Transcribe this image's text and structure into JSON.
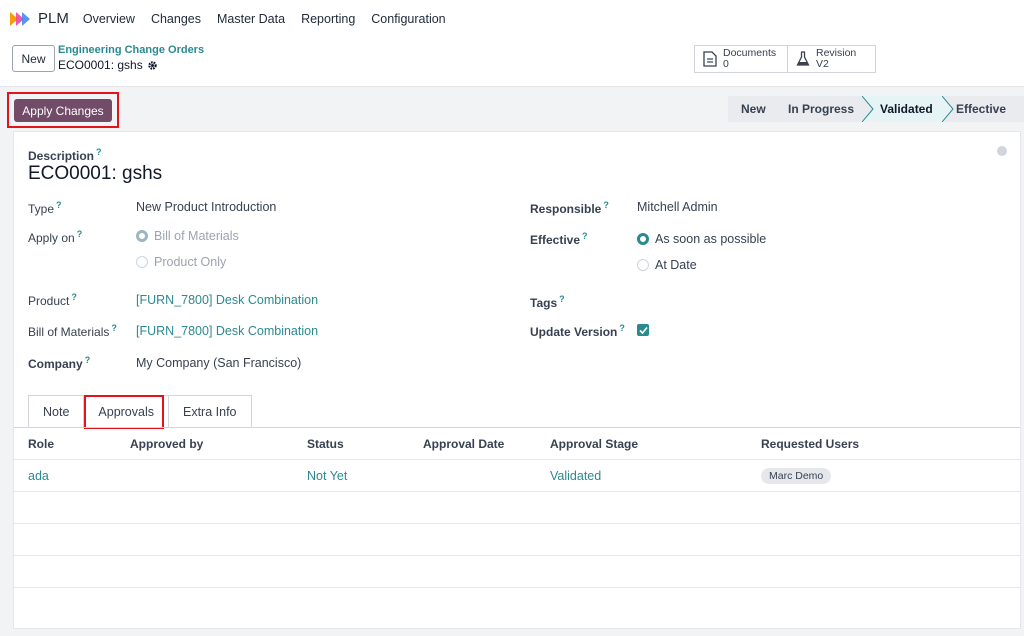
{
  "app": {
    "name": "PLM",
    "accent": "#714b67",
    "link_color": "#2a8a90"
  },
  "nav": {
    "items": [
      "Overview",
      "Changes",
      "Master Data",
      "Reporting",
      "Configuration"
    ]
  },
  "control_panel": {
    "new_label": "New",
    "breadcrumb_parent": "Engineering Change Orders",
    "breadcrumb_current": "ECO0001: gshs",
    "smart_buttons": {
      "documents": {
        "label": "Documents",
        "value": "0",
        "icon": "document-icon"
      },
      "revision": {
        "label": "Revision",
        "value": "V2",
        "icon": "flask-icon"
      }
    }
  },
  "statusbar": {
    "apply_label": "Apply Changes",
    "stages": [
      "New",
      "In Progress",
      "Validated",
      "Effective"
    ],
    "current_stage": "Validated"
  },
  "form": {
    "description_label": "Description",
    "description": "ECO0001: gshs",
    "type_label": "Type",
    "type_value": "New Product Introduction",
    "apply_on_label": "Apply on",
    "apply_on_options": [
      "Bill of Materials",
      "Product Only"
    ],
    "apply_on_selected": "Bill of Materials",
    "product_label": "Product",
    "product_value": "[FURN_7800] Desk Combination",
    "bom_label": "Bill of Materials",
    "bom_value": "[FURN_7800] Desk Combination",
    "company_label": "Company",
    "company_value": "My Company (San Francisco)",
    "responsible_label": "Responsible",
    "responsible_value": "Mitchell Admin",
    "effective_label": "Effective",
    "effective_options": [
      "As soon as possible",
      "At Date"
    ],
    "effective_selected": "As soon as possible",
    "tags_label": "Tags",
    "update_version_label": "Update Version",
    "update_version_checked": true,
    "help_mark": "?"
  },
  "tabs": {
    "items": [
      "Note",
      "Approvals",
      "Extra Info"
    ],
    "active": "Approvals"
  },
  "approvals": {
    "columns": [
      "Role",
      "Approved by",
      "Status",
      "Approval Date",
      "Approval Stage",
      "Requested Users"
    ],
    "rows": [
      {
        "role": "ada",
        "approved_by": "",
        "status": "Not Yet",
        "approval_date": "",
        "approval_stage": "Validated",
        "requested_users": "Marc Demo"
      }
    ]
  }
}
